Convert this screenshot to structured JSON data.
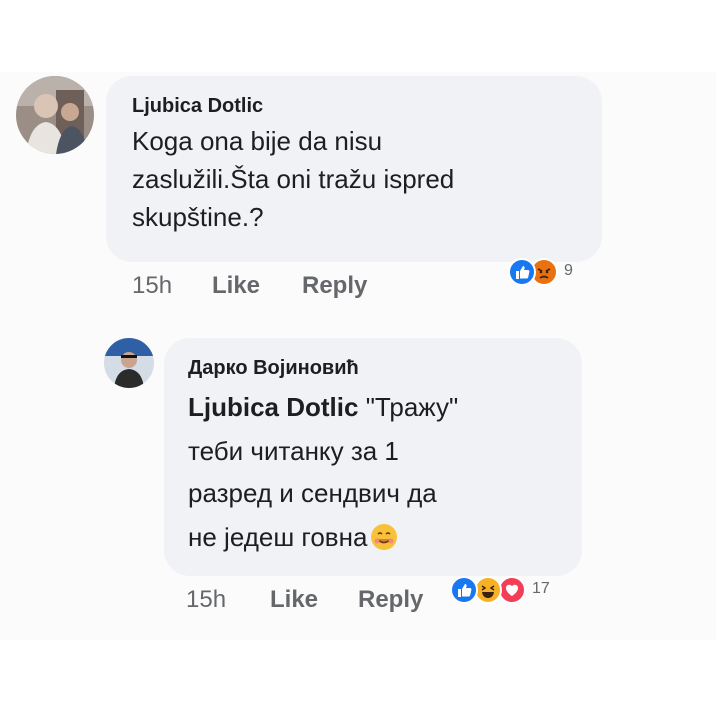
{
  "comments": [
    {
      "author": "Ljubica Dotlic",
      "lines": [
        "Koga ona bije da nisu",
        "zaslužili.Šta oni tražu ispred",
        "skupštine.?"
      ],
      "time": "15h",
      "like_label": "Like",
      "reply_label": "Reply",
      "reactions": [
        "like",
        "angry"
      ],
      "reaction_count": "9"
    },
    {
      "author": "Дарко Војиновић",
      "mention": "Ljubica Dotlic",
      "lines": [
        "\"Тражу\"",
        "теби читанку за 1",
        "разред и сендвич да",
        "не једеш говна"
      ],
      "emoji": "smiling-face-with-hearts",
      "time": "15h",
      "like_label": "Like",
      "reply_label": "Reply",
      "reactions": [
        "like",
        "haha",
        "love"
      ],
      "reaction_count": "17"
    }
  ],
  "colors": {
    "bubble": "#f0f2f5",
    "like_blue": "#1877f2",
    "angry_orange": "#e9710f",
    "love_red": "#f33e58",
    "haha_yellow": "#f7b125"
  }
}
